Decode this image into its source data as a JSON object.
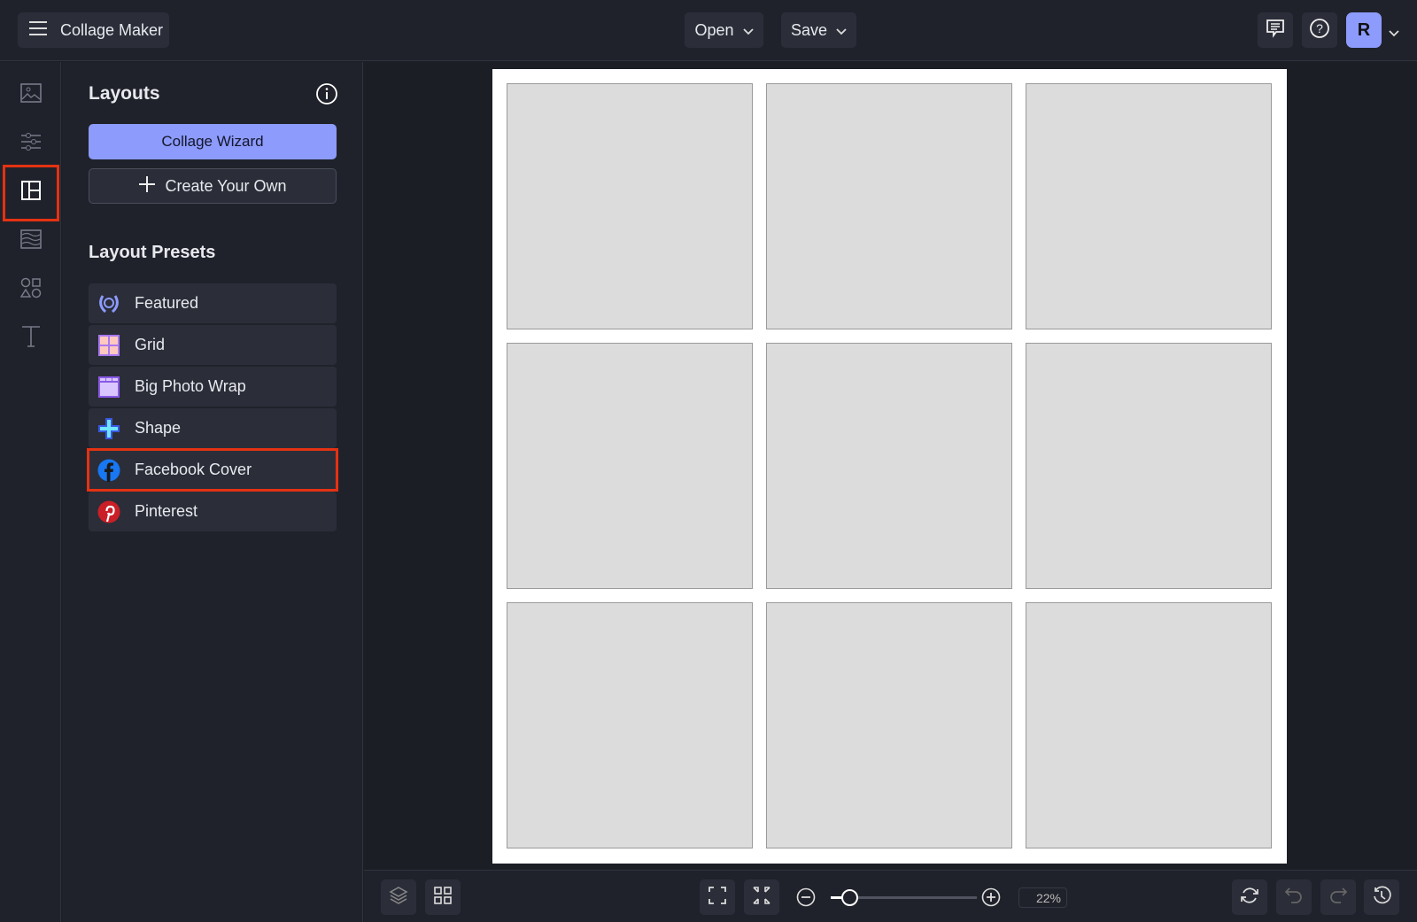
{
  "header": {
    "app_title": "Collage Maker",
    "open_label": "Open",
    "save_label": "Save",
    "avatar_initial": "R"
  },
  "rail": {
    "items": [
      "image",
      "adjustments",
      "layouts",
      "textures",
      "graphics",
      "text"
    ],
    "active": "layouts"
  },
  "panel": {
    "title": "Layouts",
    "wizard_label": "Collage Wizard",
    "create_label": "Create Your Own",
    "presets_title": "Layout Presets",
    "presets": [
      {
        "label": "Featured",
        "icon": "laurel-icon"
      },
      {
        "label": "Grid",
        "icon": "grid-icon"
      },
      {
        "label": "Big Photo Wrap",
        "icon": "photo-wrap-icon"
      },
      {
        "label": "Shape",
        "icon": "shape-icon"
      },
      {
        "label": "Facebook Cover",
        "icon": "facebook-icon"
      },
      {
        "label": "Pinterest",
        "icon": "pinterest-icon"
      }
    ],
    "highlighted": "Facebook Cover"
  },
  "canvas": {
    "rows": 3,
    "cols": 3
  },
  "bottom": {
    "zoom_label": "22%",
    "zoom_value": 22
  },
  "colors": {
    "accent": "#8c9bfc",
    "highlight": "#e53212",
    "bg": "#20222b"
  }
}
